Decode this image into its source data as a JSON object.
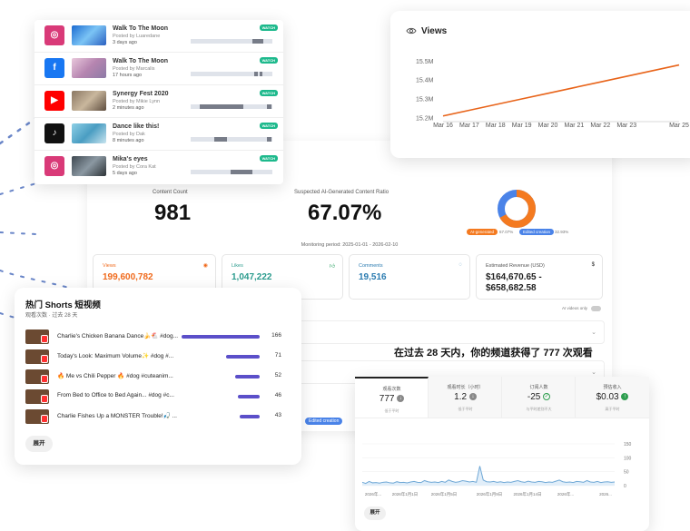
{
  "dashboard": {
    "content_count_label": "Content Count",
    "content_count": "981",
    "ai_ratio_label": "Suspected AI-Generated Content Ratio",
    "ai_ratio": "67.07%",
    "legend_ai": "AI-generated",
    "legend_ai_pct": "67.07%",
    "legend_edited": "Edited creation",
    "legend_edited_pct": "32.93%",
    "monitoring_period": "Monitoring period: 2025-01-01 - 2026-02-10",
    "metrics": [
      {
        "label": "Views",
        "value": "199,600,782",
        "color": "#f06a1c",
        "icon": "eye-icon"
      },
      {
        "label": "Likes",
        "value": "1,047,222",
        "color": "#2a9b8d",
        "icon": "thumb-up-icon"
      },
      {
        "label": "Comments",
        "value": "19,516",
        "color": "#2a7bb0",
        "icon": "comment-icon"
      },
      {
        "label": "Estimated Revenue (USD)",
        "value": "$164,670.65 -\n$658,682.58",
        "color": "#222222",
        "icon": "dollar-icon"
      }
    ],
    "ai_videos_only": "AI videos only",
    "edited_tag": "Edited creation",
    "donut_colors": {
      "ai": "#f47a20",
      "edited": "#4a83e8"
    }
  },
  "social_posts": [
    {
      "platform": "instagram-icon",
      "color": "#d93a78",
      "title": "Walk To The Moon",
      "posted_by": "Posted by Luaredane",
      "time": "3 days ago",
      "badge": "WATCH",
      "thumb": "#3b7fd8"
    },
    {
      "platform": "facebook-icon",
      "color": "#1877f2",
      "title": "Walk To The Moon",
      "posted_by": "Posted by Marcalis",
      "time": "17 hours ago",
      "badge": "WATCH",
      "thumb": "#c49ec0"
    },
    {
      "platform": "youtube-icon",
      "color": "#ff0000",
      "title": "Synergy Fest 2020",
      "posted_by": "Posted by Mikie Lynn",
      "time": "2 minutes ago",
      "badge": "WATCH",
      "thumb": "#7a6a5a"
    },
    {
      "platform": "tiktok-icon",
      "color": "#111111",
      "title": "Dance like this!",
      "posted_by": "Posted by Dak",
      "time": "8 minutes ago",
      "badge": "WATCH",
      "thumb": "#5aa8c8"
    },
    {
      "platform": "instagram-icon",
      "color": "#d93a78",
      "title": "Mika's eyes",
      "posted_by": "Posted by Cora Kat",
      "time": "5 days ago",
      "badge": "WATCH",
      "thumb": "#54606a"
    }
  ],
  "views_chart": {
    "title": "Views",
    "chart_data": {
      "type": "line",
      "x": [
        "Mar 16",
        "Mar 17",
        "Mar 18",
        "Mar 19",
        "Mar 20",
        "Mar 21",
        "Mar 22",
        "Mar 23",
        "Mar 24",
        "Mar 25"
      ],
      "x_tick_labels": [
        "Mar 16",
        "Mar 17",
        "Mar 18",
        "Mar 19",
        "Mar 20",
        "Mar 21",
        "Mar 22",
        "Mar 23",
        "Mar 25"
      ],
      "y": [
        15.21,
        15.24,
        15.27,
        15.3,
        15.33,
        15.36,
        15.39,
        15.42,
        15.45,
        15.48
      ],
      "y_tick_labels": [
        "15.5M",
        "15.4M",
        "15.3M",
        "15.2M"
      ],
      "y_ticks": [
        15.5,
        15.4,
        15.3,
        15.2
      ],
      "ylim": [
        15.18,
        15.55
      ],
      "color": "#e8641a"
    }
  },
  "shorts": {
    "title": "热门 Shorts 短视频",
    "subtitle": "观看次数 · 过去 28 天",
    "expand": "展开",
    "items": [
      {
        "text": "Charlie's Chicken Banana Dance🍌🐔 #dog...",
        "value": 166
      },
      {
        "text": "Today's Look: Maximum Volume✨ #dog #...",
        "value": 71
      },
      {
        "text": "🔥 Me vs Chili Pepper 🔥 #dog #cuteanim...",
        "value": 52
      },
      {
        "text": "From Bed to Office to Bed Again... #dog #c...",
        "value": 46
      },
      {
        "text": "Charlie Fishes Up a MONSTER Trouble!🎣 ...",
        "value": 43
      }
    ]
  },
  "caption": "在过去 28 天内，你的频道获得了 777 次观看",
  "analytics": {
    "columns": [
      {
        "label": "观看次数",
        "value": "777",
        "note": "低于平时",
        "status": "down"
      },
      {
        "label": "观看时长（小时）",
        "value": "1.2",
        "note": "低于平时",
        "status": "down"
      },
      {
        "label": "订阅人数",
        "value": "-25",
        "note": "与平时差别不大",
        "status": "ok"
      },
      {
        "label": "预估收入",
        "value": "$0.03",
        "note": "高于平时",
        "status": "up"
      }
    ],
    "expand": "展开",
    "chart_data": {
      "type": "line",
      "y_tick_labels": [
        "150",
        "100",
        "50",
        "0"
      ],
      "ylim": [
        0,
        150
      ],
      "x_tick_labels": [
        "2026年...",
        "2026年1月1日",
        "2026年1月5日",
        "2026年1月9日",
        "2026年1月14日",
        "2026年...",
        "2026..."
      ],
      "values": [
        12,
        8,
        15,
        10,
        11,
        9,
        12,
        13,
        10,
        9,
        14,
        11,
        12,
        10,
        13,
        15,
        12,
        11,
        18,
        14,
        12,
        13,
        11,
        15,
        12,
        20,
        15,
        12,
        14,
        18,
        16,
        13,
        15,
        12,
        70,
        20,
        14,
        13,
        15,
        12,
        14,
        11,
        13,
        12,
        15,
        18,
        14,
        12,
        16,
        13,
        12,
        15,
        14,
        11,
        13,
        12,
        16,
        20,
        14,
        12,
        13,
        11,
        15,
        14,
        12,
        18,
        13,
        12,
        15,
        11,
        13,
        14,
        12,
        13
      ],
      "color": "#6fa8d6",
      "fill": "#e1eef9"
    }
  }
}
